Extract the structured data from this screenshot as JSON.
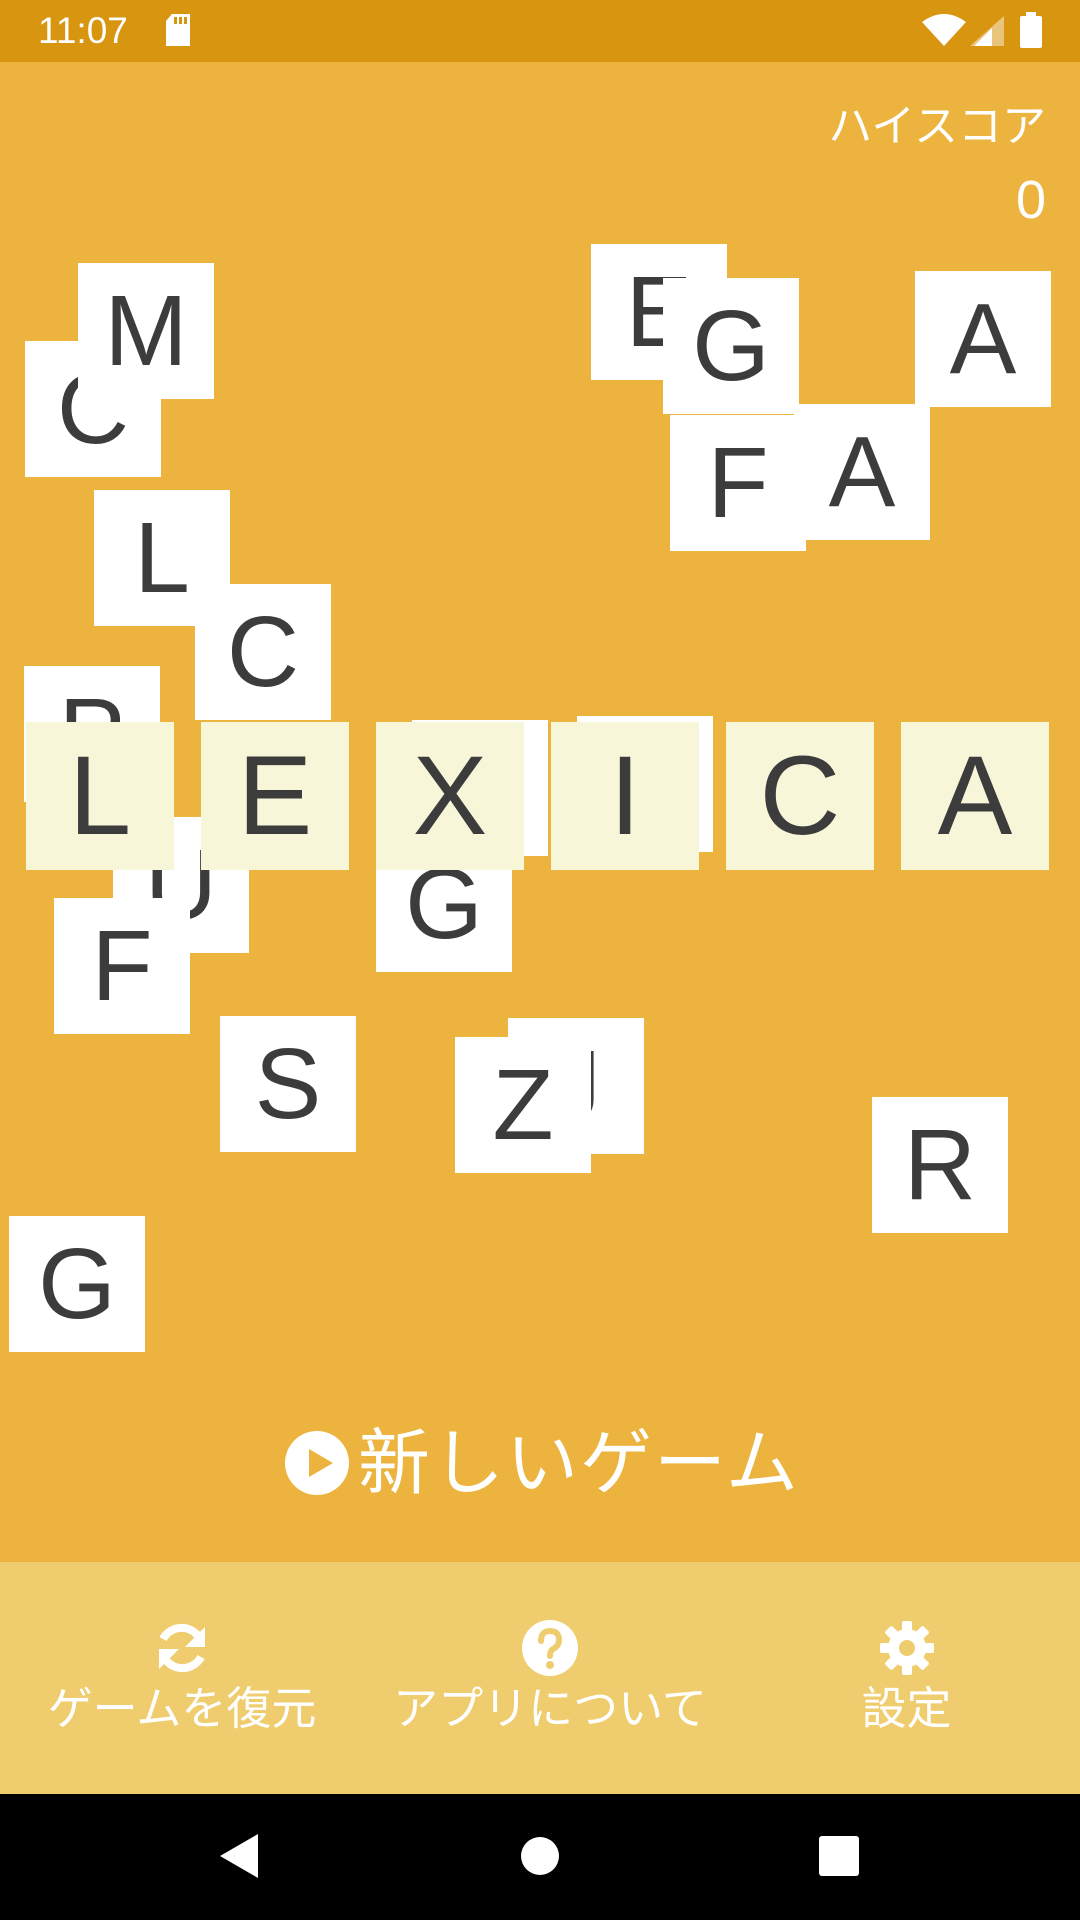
{
  "status_bar": {
    "time": "11:07",
    "icons": [
      "sd-card-icon",
      "wifi-icon",
      "signal-icon",
      "battery-icon"
    ]
  },
  "high_score": {
    "label": "ハイスコア",
    "value": "0"
  },
  "scattered_tiles": [
    {
      "letter": "C"
    },
    {
      "letter": "M"
    },
    {
      "letter": "L"
    },
    {
      "letter": "C"
    },
    {
      "letter": "P"
    },
    {
      "letter": "U"
    },
    {
      "letter": "F"
    },
    {
      "letter": "S"
    },
    {
      "letter": "G"
    },
    {
      "letter": "J"
    },
    {
      "letter": "Z"
    },
    {
      "letter": "R"
    },
    {
      "letter": "G"
    },
    {
      "letter": "E"
    },
    {
      "letter": "G"
    },
    {
      "letter": "A"
    },
    {
      "letter": "A"
    },
    {
      "letter": "F"
    },
    {
      "letter": ""
    },
    {
      "letter": ""
    }
  ],
  "title_letters": [
    "L",
    "E",
    "X",
    "I",
    "C",
    "A"
  ],
  "new_game": {
    "icon": "play-circle-icon",
    "label": "新しいゲーム"
  },
  "bottom_bar": {
    "restore": {
      "icon": "refresh-icon",
      "label": "ゲームを復元"
    },
    "about": {
      "icon": "question-circle-icon",
      "label": "アプリについて"
    },
    "settings": {
      "icon": "gear-icon",
      "label": "設定"
    }
  },
  "nav_bar": {
    "icons": [
      "back-icon",
      "home-icon",
      "recents-icon"
    ]
  },
  "colors": {
    "background": "#ecb43f",
    "status_bar": "#d8950f",
    "bottom_bar": "#efcd6e",
    "tile": "#ffffff",
    "title_tile": "#f8f6d8",
    "tile_text": "#3c3c3c"
  }
}
